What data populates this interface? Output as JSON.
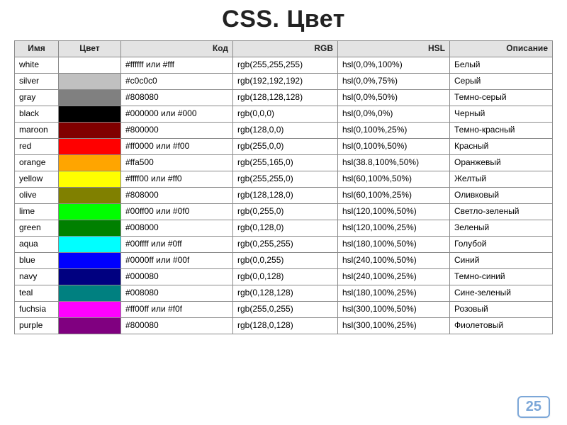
{
  "title": "CSS. Цвет",
  "page_number": "25",
  "headers": {
    "name": "Имя",
    "swatch": "Цвет",
    "code": "Код",
    "rgb": "RGB",
    "hsl": "HSL",
    "desc": "Описание"
  },
  "rows": [
    {
      "name": "white",
      "hex": "#ffffff",
      "code": "#ffffff или #fff",
      "rgb": "rgb(255,255,255)",
      "hsl": "hsl(0,0%,100%)",
      "desc": "Белый"
    },
    {
      "name": "silver",
      "hex": "#c0c0c0",
      "code": "#c0c0c0",
      "rgb": "rgb(192,192,192)",
      "hsl": "hsl(0,0%,75%)",
      "desc": "Серый"
    },
    {
      "name": "gray",
      "hex": "#808080",
      "code": "#808080",
      "rgb": "rgb(128,128,128)",
      "hsl": "hsl(0,0%,50%)",
      "desc": "Темно-серый"
    },
    {
      "name": "black",
      "hex": "#000000",
      "code": "#000000 или #000",
      "rgb": "rgb(0,0,0)",
      "hsl": "hsl(0,0%,0%)",
      "desc": "Черный"
    },
    {
      "name": "maroon",
      "hex": "#800000",
      "code": "#800000",
      "rgb": "rgb(128,0,0)",
      "hsl": "hsl(0,100%,25%)",
      "desc": "Темно-красный"
    },
    {
      "name": "red",
      "hex": "#ff0000",
      "code": "#ff0000 или #f00",
      "rgb": "rgb(255,0,0)",
      "hsl": "hsl(0,100%,50%)",
      "desc": "Красный"
    },
    {
      "name": "orange",
      "hex": "#ffa500",
      "code": "#ffa500",
      "rgb": "rgb(255,165,0)",
      "hsl": "hsl(38.8,100%,50%)",
      "desc": "Оранжевый"
    },
    {
      "name": "yellow",
      "hex": "#ffff00",
      "code": "#ffff00 или #ff0",
      "rgb": "rgb(255,255,0)",
      "hsl": "hsl(60,100%,50%)",
      "desc": "Желтый"
    },
    {
      "name": "olive",
      "hex": "#808000",
      "code": "#808000",
      "rgb": "rgb(128,128,0)",
      "hsl": "hsl(60,100%,25%)",
      "desc": "Оливковый"
    },
    {
      "name": "lime",
      "hex": "#00ff00",
      "code": "#00ff00 или #0f0",
      "rgb": "rgb(0,255,0)",
      "hsl": "hsl(120,100%,50%)",
      "desc": "Светло-зеленый"
    },
    {
      "name": "green",
      "hex": "#008000",
      "code": "#008000",
      "rgb": "rgb(0,128,0)",
      "hsl": "hsl(120,100%,25%)",
      "desc": "Зеленый"
    },
    {
      "name": "aqua",
      "hex": "#00ffff",
      "code": "#00ffff или #0ff",
      "rgb": "rgb(0,255,255)",
      "hsl": "hsl(180,100%,50%)",
      "desc": "Голубой"
    },
    {
      "name": "blue",
      "hex": "#0000ff",
      "code": "#0000ff или #00f",
      "rgb": "rgb(0,0,255)",
      "hsl": "hsl(240,100%,50%)",
      "desc": "Синий"
    },
    {
      "name": "navy",
      "hex": "#000080",
      "code": "#000080",
      "rgb": "rgb(0,0,128)",
      "hsl": "hsl(240,100%,25%)",
      "desc": "Темно-синий"
    },
    {
      "name": "teal",
      "hex": "#008080",
      "code": "#008080",
      "rgb": "rgb(0,128,128)",
      "hsl": "hsl(180,100%,25%)",
      "desc": "Сине-зеленый"
    },
    {
      "name": "fuchsia",
      "hex": "#ff00ff",
      "code": "#ff00ff или #f0f",
      "rgb": "rgb(255,0,255)",
      "hsl": "hsl(300,100%,50%)",
      "desc": "Розовый"
    },
    {
      "name": "purple",
      "hex": "#800080",
      "code": "#800080",
      "rgb": "rgb(128,0,128)",
      "hsl": "hsl(300,100%,25%)",
      "desc": "Фиолетовый"
    }
  ]
}
